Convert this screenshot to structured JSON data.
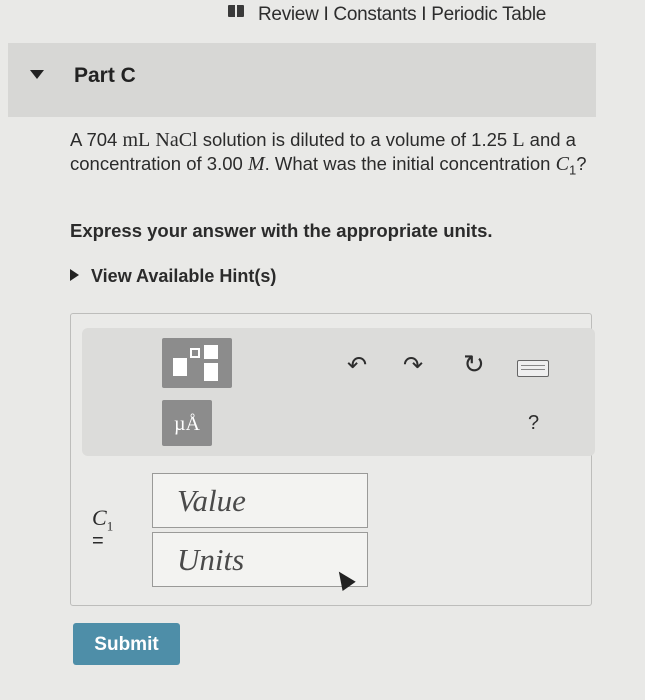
{
  "topbar": {
    "links": "Review I Constants I Periodic Table"
  },
  "part": {
    "title": "Part C"
  },
  "question": {
    "t1": "A 704 ",
    "unit_ml": "mL",
    "t2": " ",
    "compound": "NaCl",
    "t3": " solution is diluted to a volume of 1.25 ",
    "unit_l": "L",
    "t4": " and a concentration of 3.00 ",
    "unit_m": "M",
    "t5": ". What was the initial concentration ",
    "var": "C",
    "var_sub": "1",
    "t6": "?"
  },
  "instruction": "Express your answer with the appropriate units.",
  "hint_link": "View Available Hint(s)",
  "toolbar": {
    "unit_button_label": "µÅ",
    "help_label": "?"
  },
  "answer": {
    "var": "C",
    "var_sub": "1",
    "equals": "=",
    "value_placeholder": "Value",
    "units_placeholder": "Units"
  },
  "submit_label": "Submit",
  "icons": {
    "undo": "undo-icon",
    "redo": "redo-icon",
    "reset": "reset-icon",
    "keyboard": "keyboard-icon",
    "templates": "templates-icon"
  }
}
